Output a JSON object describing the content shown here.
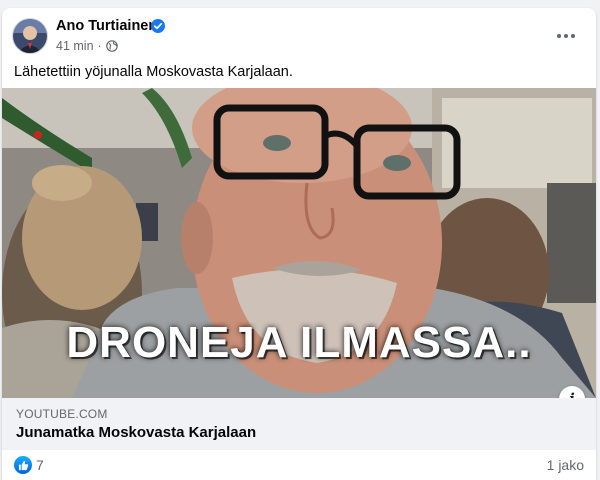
{
  "post": {
    "author": "Ano Turtiainen",
    "time": "41 min",
    "separator": "·",
    "text": "Lähetettiin yöjunalla Moskovasta Karjalaan.",
    "more_icon": "more-icon"
  },
  "link": {
    "thumbnail_caption": "DRONEJA ILMASSA..",
    "domain": "YOUTUBE.COM",
    "title": "Junamatka Moskovasta Karjalaan",
    "info_label": "i"
  },
  "engagement": {
    "reaction_icon": "like-icon",
    "reaction_count": "7",
    "share_count": "1 jako"
  },
  "colors": {
    "accent": "#1877f2",
    "secondary_text": "#65676b",
    "link_bg": "#f0f2f5"
  }
}
